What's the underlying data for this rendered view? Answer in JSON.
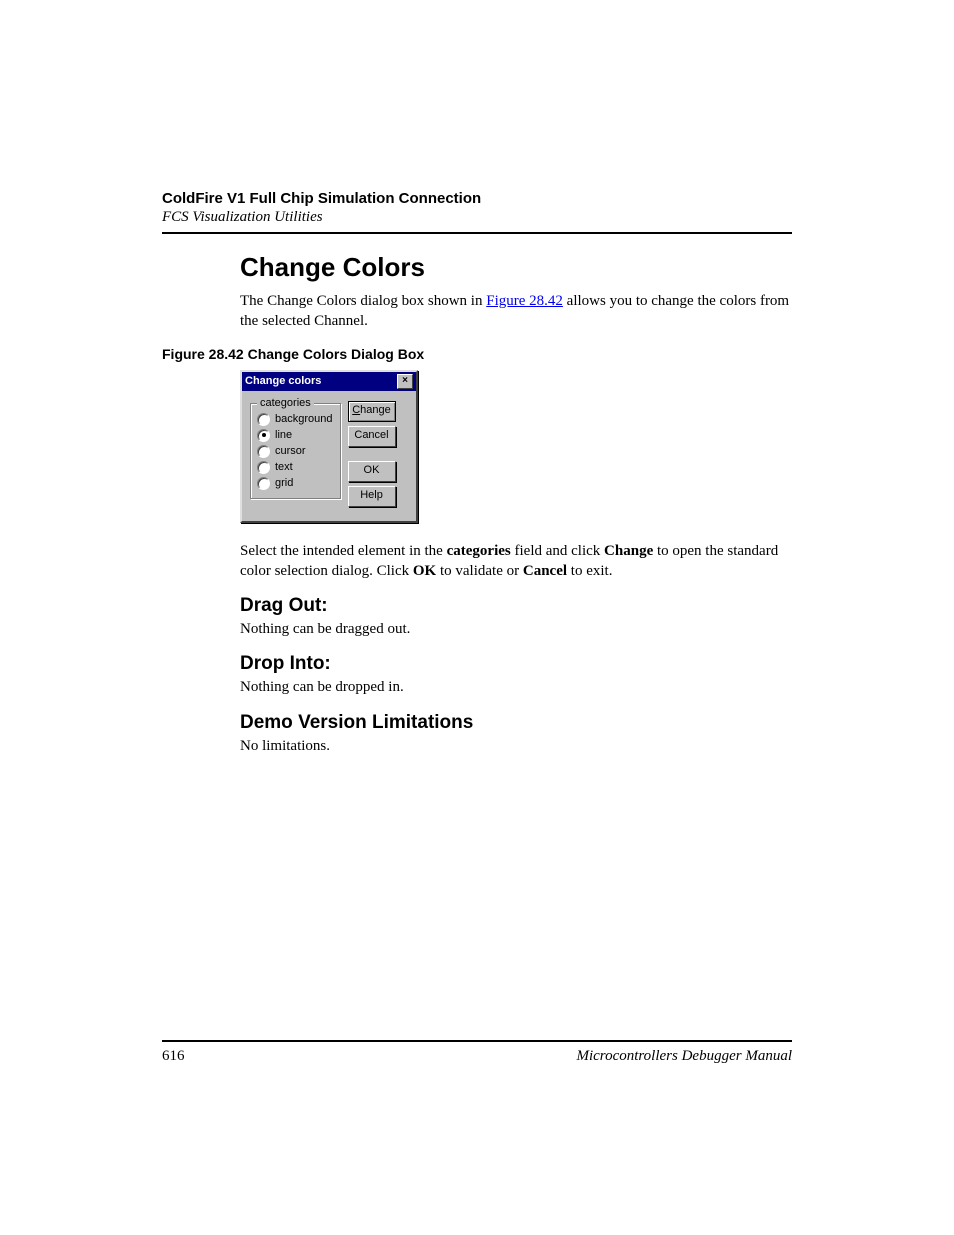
{
  "header": {
    "title": "ColdFire V1 Full Chip Simulation Connection",
    "subtitle": "FCS Visualization Utilities"
  },
  "section": {
    "heading": "Change Colors",
    "intro_pre": "The Change Colors dialog box shown in ",
    "intro_link": "Figure 28.42",
    "intro_post": " allows you to change the colors from the selected Channel."
  },
  "figure": {
    "caption": "Figure 28.42  Change Colors Dialog Box"
  },
  "dialog": {
    "title": "Change colors",
    "group_label": "categories",
    "options": {
      "background": "background",
      "line": "line",
      "cursor": "cursor",
      "text": "text",
      "grid": "grid"
    },
    "buttons": {
      "change_prefix": "C",
      "change_rest": "hange",
      "cancel": "Cancel",
      "ok": "OK",
      "help": "Help"
    }
  },
  "instruction": {
    "p1": "Select the intended element in the ",
    "b1": "categories",
    "p2": " field and click ",
    "b2": "Change",
    "p3": " to open the standard color selection dialog. Click ",
    "b3": "OK",
    "p4": " to validate or ",
    "b4": "Cancel",
    "p5": " to exit."
  },
  "dragout": {
    "heading": "Drag Out:",
    "body": "Nothing can be dragged out."
  },
  "dropinto": {
    "heading": "Drop Into:",
    "body": "Nothing can be dropped in."
  },
  "demo": {
    "heading": "Demo Version Limitations",
    "body": "No limitations."
  },
  "footer": {
    "page": "616",
    "manual": "Microcontrollers Debugger Manual"
  }
}
